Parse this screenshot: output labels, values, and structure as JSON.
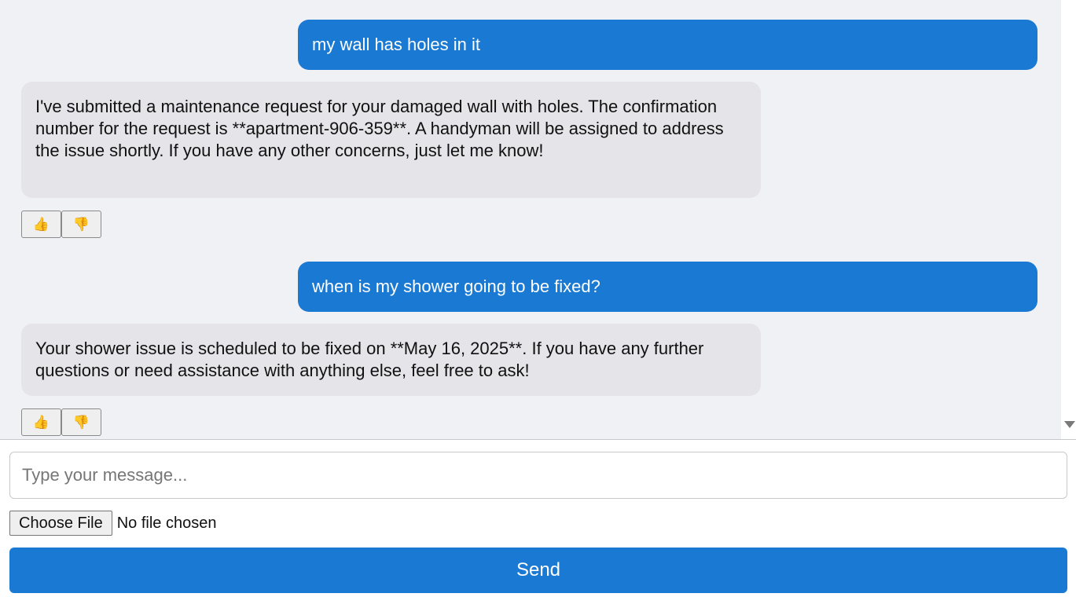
{
  "messages": [
    {
      "role": "user",
      "text": "my wall has holes in it"
    },
    {
      "role": "assistant",
      "text": "I've submitted a maintenance request for your damaged wall with holes. The confirmation number for the request is **apartment-906-359**. A handyman will be assigned to address the issue shortly. If you have any other concerns, just let me know!"
    },
    {
      "role": "user",
      "text": "when is my shower going to be fixed?"
    },
    {
      "role": "assistant",
      "text": "Your shower issue is scheduled to be fixed on **May 16, 2025**. If you have any further questions or need assistance with anything else, feel free to ask!"
    }
  ],
  "feedback": {
    "thumbs_up": "👍",
    "thumbs_down": "👎"
  },
  "composer": {
    "placeholder": "Type your message...",
    "value": "",
    "file_button_label": "Choose File",
    "file_status": "No file chosen",
    "send_label": "Send"
  },
  "colors": {
    "accent": "#1a79d2",
    "bot_bubble": "#e4e4e9",
    "chat_background": "#f0f1f5"
  },
  "icons": [
    "thumbs-up-icon",
    "thumbs-down-icon",
    "scroll-down-arrow-icon"
  ]
}
